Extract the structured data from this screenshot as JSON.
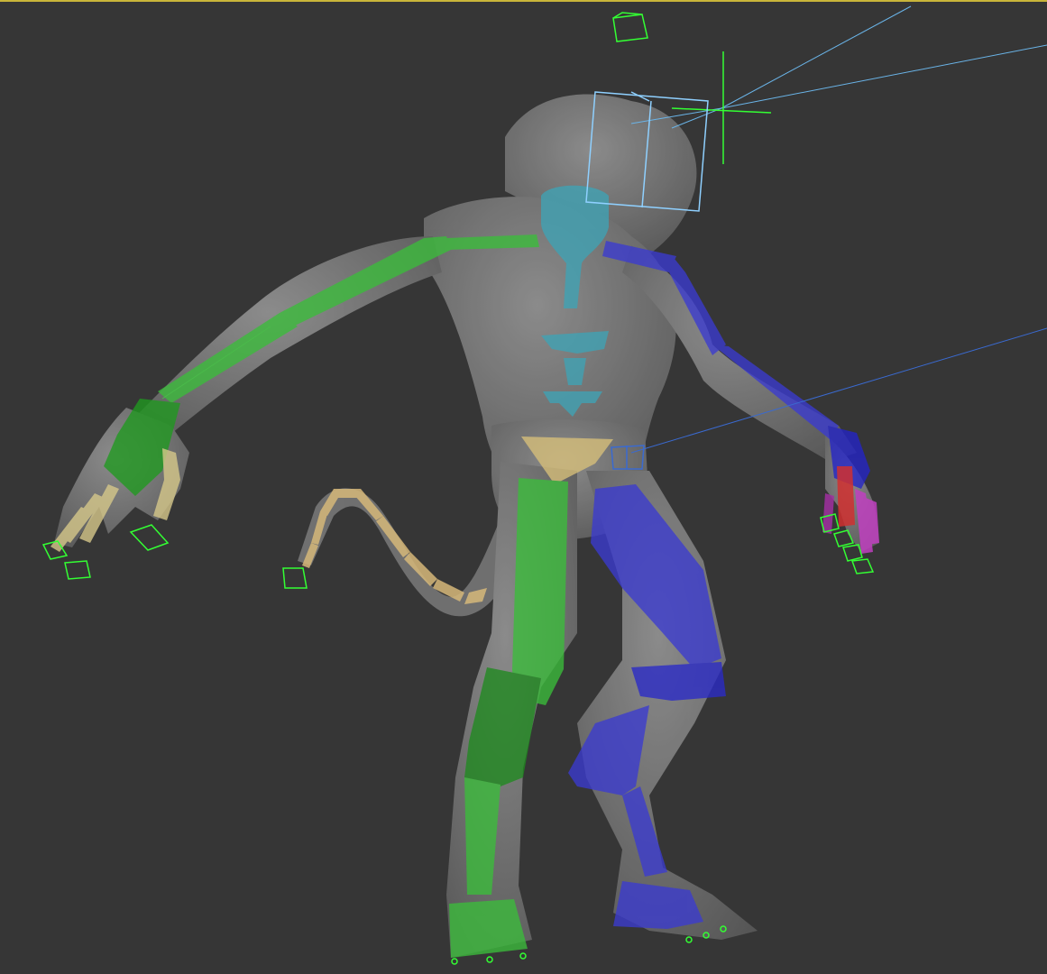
{
  "viewport": {
    "active_border_color": "#c9b53a",
    "background_color": "#363636"
  },
  "scene": {
    "mesh_color": "#8a8a8a",
    "bone_colors": {
      "left_side": "#3bbd3b",
      "right_side": "#3b3bd0",
      "spine": "#3fa3b5",
      "pelvis": "#d8c07a",
      "fingers_left": "#d6c88a",
      "fingers_right": "#c040c0",
      "tail": "#d6b87a",
      "selected_finger": "#d03030"
    },
    "helper_color": "#33ff33",
    "camera_target_color": "#8fd0ff"
  }
}
